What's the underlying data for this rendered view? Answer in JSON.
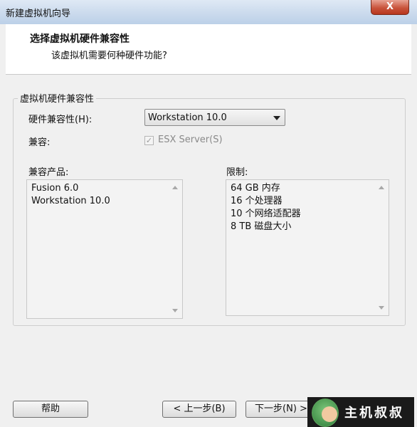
{
  "window": {
    "title": "新建虚拟机向导",
    "close_label": "X"
  },
  "header": {
    "title": "选择虚拟机硬件兼容性",
    "subtitle": "该虚拟机需要何种硬件功能?"
  },
  "group": {
    "legend": "虚拟机硬件兼容性",
    "hardware_label": "硬件兼容性(H):",
    "hardware_value": "Workstation 10.0",
    "compatible_label": "兼容:",
    "esx_label": "ESX Server(S)",
    "esx_checked": true,
    "products_label": "兼容产品:",
    "products": [
      "Fusion 6.0",
      "Workstation 10.0"
    ],
    "limits_label": "限制:",
    "limits": [
      "64 GB 内存",
      "16 个处理器",
      "10 个网络适配器",
      "8 TB 磁盘大小"
    ]
  },
  "buttons": {
    "help": "帮助",
    "back": "< 上一步(B)",
    "next": "下一步(N) >"
  },
  "logo": {
    "text": "主机叔叔"
  },
  "colors": {
    "titlebar": "#c9d9ec",
    "close": "#c9543c",
    "background": "#f0f0f0"
  }
}
